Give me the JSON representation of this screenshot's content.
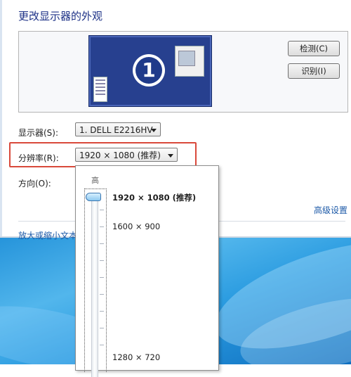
{
  "window": {
    "title": "更改显示器的外观"
  },
  "preview": {
    "monitor_number": "1"
  },
  "buttons": {
    "detect": "检测(C)",
    "identify": "识别(I)"
  },
  "settings": {
    "display_label": "显示器(S):",
    "display_value": "1. DELL E2216HV",
    "resolution_label": "分辨率(R):",
    "resolution_value": "1920 × 1080 (推荐)",
    "orientation_label": "方向(O):"
  },
  "links": {
    "advanced": "高级设置",
    "text_size": "放大或缩小文本"
  },
  "resolution_dropdown": {
    "high_label": "高",
    "options": [
      {
        "label": "1920 × 1080 (推荐)",
        "selected": true
      },
      {
        "label": "1600 × 900",
        "selected": false
      },
      {
        "label": "1280 × 720",
        "selected": false
      }
    ]
  },
  "colors": {
    "highlight_border": "#d9493b",
    "link": "#1d5aa8",
    "title": "#1e3287",
    "monitor": "#27408f"
  }
}
